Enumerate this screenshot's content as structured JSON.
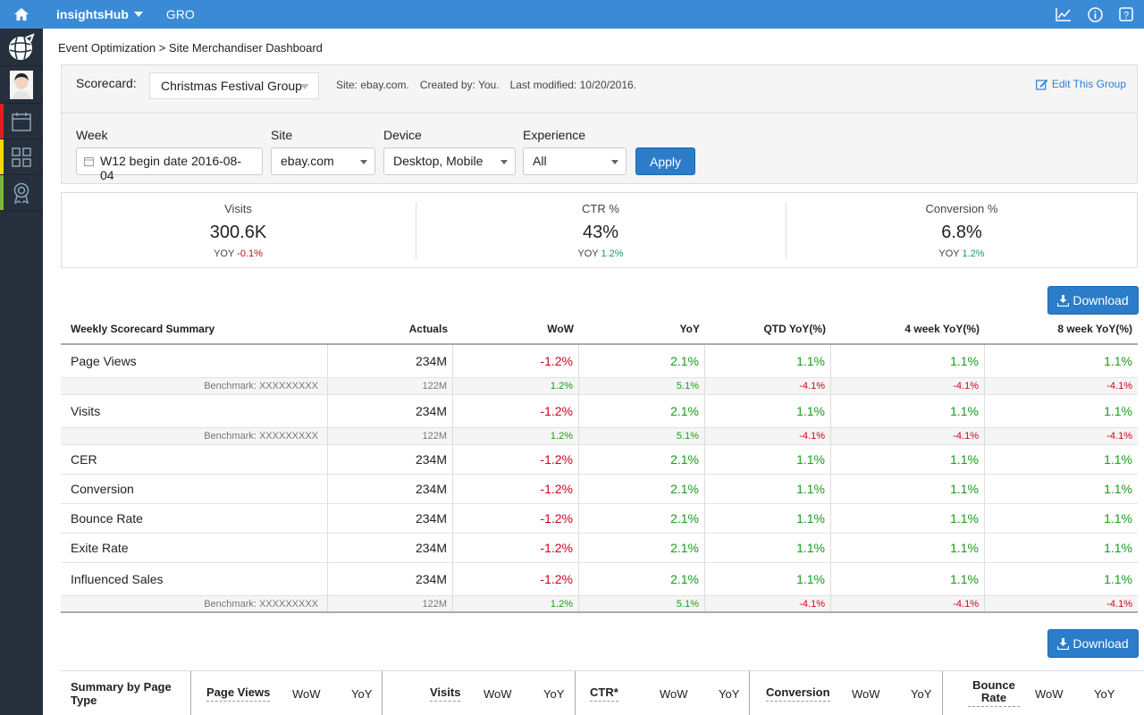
{
  "topbar": {
    "brand": "insightsHub",
    "module": "GRO"
  },
  "breadcrumb": "Event Optimization > Site Merchandiser Dashboard",
  "scorecard": {
    "label": "Scorecard:",
    "selected": "Christmas Festival Group",
    "site": "Site: ebay.com.",
    "created_by": "Created by: You.",
    "last_modified": "Last  modified: 10/20/2016.",
    "edit_link": "Edit This Group"
  },
  "filters": {
    "week_label": "Week",
    "week_value": "W12 begin date 2016-08-04",
    "site_label": "Site",
    "site_value": "ebay.com",
    "device_label": "Device",
    "device_value": "Desktop, Mobile",
    "experience_label": "Experience",
    "experience_value": "All",
    "apply": "Apply"
  },
  "kpis": [
    {
      "title": "Visits",
      "value": "300.6K",
      "yoy_label": "YOY",
      "yoy": "-0.1%"
    },
    {
      "title": "CTR %",
      "value": "43%",
      "yoy_label": "YOY",
      "yoy": "1.2%"
    },
    {
      "title": "Conversion %",
      "value": "6.8%",
      "yoy_label": "YOY",
      "yoy": "1.2%"
    }
  ],
  "download_label": "Download",
  "weekly_table": {
    "headers": [
      "Weekly Scorecard Summary",
      "Actuals",
      "WoW",
      "YoY",
      "QTD YoY(%)",
      "4 week YoY(%)",
      "8 week YoY(%)"
    ],
    "rows": [
      {
        "name": "Page Views",
        "actuals": "234M",
        "wow": "-1.2%",
        "yoy": "2.1%",
        "qtd": "1.1%",
        "w4": "1.1%",
        "w8": "1.1%",
        "bench": {
          "label": "Benchmark: XXXXXXXXX",
          "actuals": "122M",
          "wow": "1.2%",
          "yoy": "5.1%",
          "qtd": "-4.1%",
          "w4": "-4.1%",
          "w8": "-4.1%"
        }
      },
      {
        "name": "Visits",
        "actuals": "234M",
        "wow": "-1.2%",
        "yoy": "2.1%",
        "qtd": "1.1%",
        "w4": "1.1%",
        "w8": "1.1%",
        "bench": {
          "label": "Benchmark: XXXXXXXXX",
          "actuals": "122M",
          "wow": "1.2%",
          "yoy": "5.1%",
          "qtd": "-4.1%",
          "w4": "-4.1%",
          "w8": "-4.1%"
        }
      },
      {
        "name": "CER",
        "actuals": "234M",
        "wow": "-1.2%",
        "yoy": "2.1%",
        "qtd": "1.1%",
        "w4": "1.1%",
        "w8": "1.1%"
      },
      {
        "name": "Conversion",
        "actuals": "234M",
        "wow": "-1.2%",
        "yoy": "2.1%",
        "qtd": "1.1%",
        "w4": "1.1%",
        "w8": "1.1%"
      },
      {
        "name": "Bounce Rate",
        "actuals": "234M",
        "wow": "-1.2%",
        "yoy": "2.1%",
        "qtd": "1.1%",
        "w4": "1.1%",
        "w8": "1.1%"
      },
      {
        "name": "Exite Rate",
        "actuals": "234M",
        "wow": "-1.2%",
        "yoy": "2.1%",
        "qtd": "1.1%",
        "w4": "1.1%",
        "w8": "1.1%"
      },
      {
        "name": "Influenced Sales",
        "actuals": "234M",
        "wow": "-1.2%",
        "yoy": "2.1%",
        "qtd": "1.1%",
        "w4": "1.1%",
        "w8": "1.1%",
        "bench": {
          "label": "Benchmark: XXXXXXXXX",
          "actuals": "122M",
          "wow": "1.2%",
          "yoy": "5.1%",
          "qtd": "-4.1%",
          "w4": "-4.1%",
          "w8": "-4.1%"
        }
      }
    ]
  },
  "page_type_table": {
    "title": "Summary by Page Type",
    "groups": [
      {
        "name": "Page Views",
        "wow": "WoW",
        "yoy": "YoY"
      },
      {
        "name": "Visits",
        "wow": "WoW",
        "yoy": "YoY"
      },
      {
        "name": "CTR*",
        "wow": "WoW",
        "yoy": "YoY"
      },
      {
        "name": "Conversion",
        "wow": "WoW",
        "yoy": "YoY"
      },
      {
        "name": "Bounce Rate",
        "wow": "WoW",
        "yoy": "YoY"
      }
    ]
  },
  "colors": {
    "topbar": "#3a8ad6",
    "sidebar": "#25303c",
    "button": "#2b7cc9",
    "negative": "#d0021b",
    "positive": "#1a9c1a"
  }
}
